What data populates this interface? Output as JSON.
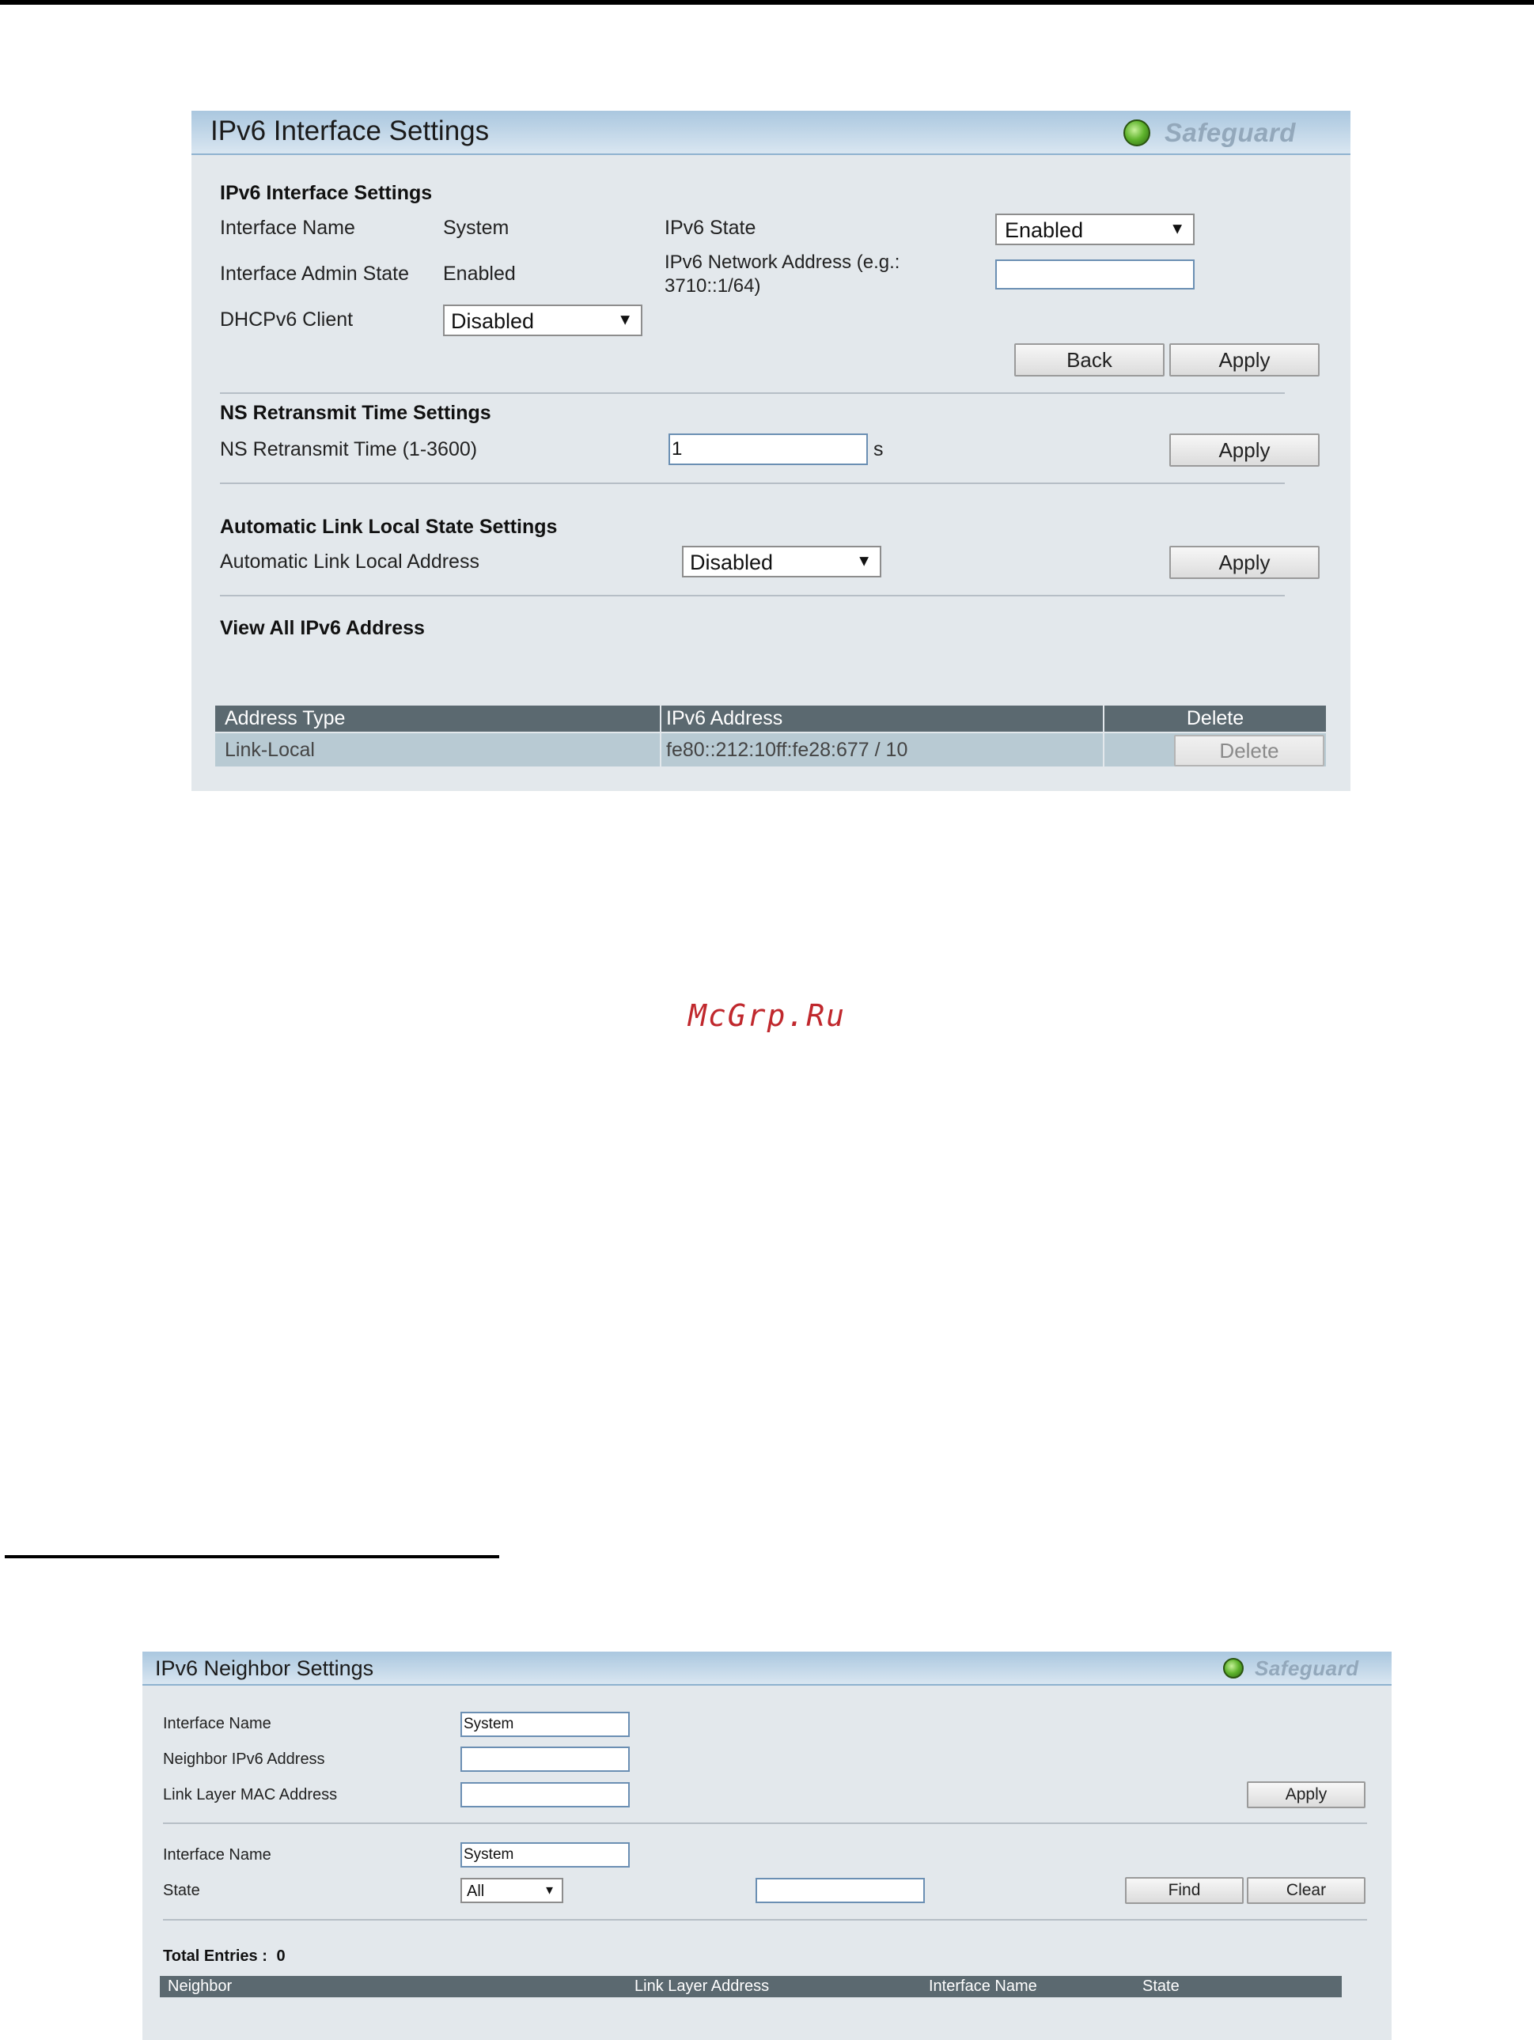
{
  "panel1": {
    "title": "IPv6 Interface Settings",
    "safeguard": "Safeguard",
    "section_interface": "IPv6 Interface Settings",
    "interface_name_label": "Interface Name",
    "interface_name_value": "System",
    "ipv6_state_label": "IPv6 State",
    "ipv6_state_value": "Enabled",
    "admin_state_label": "Interface Admin State",
    "admin_state_value": "Enabled",
    "network_address_label_line1": "IPv6 Network Address (e.g.:",
    "network_address_label_line2": "3710::1/64)",
    "network_address_value": "",
    "dhcpv6_label": "DHCPv6 Client",
    "dhcpv6_value": "Disabled",
    "back_label": "Back",
    "apply_label": "Apply",
    "section_ns": "NS Retransmit Time Settings",
    "ns_label": "NS Retransmit Time (1-3600)",
    "ns_value": "1",
    "ns_unit": "s",
    "section_link_local": "Automatic Link Local State Settings",
    "link_local_label": "Automatic Link Local Address",
    "link_local_value": "Disabled",
    "section_view_all": "View All IPv6 Address",
    "table": {
      "headers": [
        "Address Type",
        "IPv6 Address",
        "Delete"
      ],
      "rows": [
        {
          "type": "Link-Local",
          "address": "fe80::212:10ff:fe28:677 / 10",
          "delete": "Delete"
        }
      ]
    }
  },
  "watermark": "McGrp.Ru",
  "panel2": {
    "title": "IPv6 Neighbor Settings",
    "safeguard": "Safeguard",
    "interface_name_label": "Interface Name",
    "interface_name_value": "System",
    "neighbor_label": "Neighbor IPv6 Address",
    "neighbor_value": "",
    "mac_label": "Link Layer MAC Address",
    "mac_value": "",
    "apply_label": "Apply",
    "interface_name2_label": "Interface Name",
    "interface_name2_value": "System",
    "state_label": "State",
    "state_value": "All",
    "state_search_value": "",
    "find_label": "Find",
    "clear_label": "Clear",
    "total_entries_label": "Total Entries :",
    "total_entries_value": "0",
    "table_headers": [
      "Neighbor",
      "Link Layer Address",
      "Interface Name",
      "State"
    ]
  },
  "colors": {
    "header_gradient_top": "#aac7df",
    "panel_bg": "#e3e8ec",
    "table_header": "#5b6970",
    "table_row": "#b8cad3",
    "safeguard_led": "#5fb42d",
    "watermark": "#c0282d"
  }
}
